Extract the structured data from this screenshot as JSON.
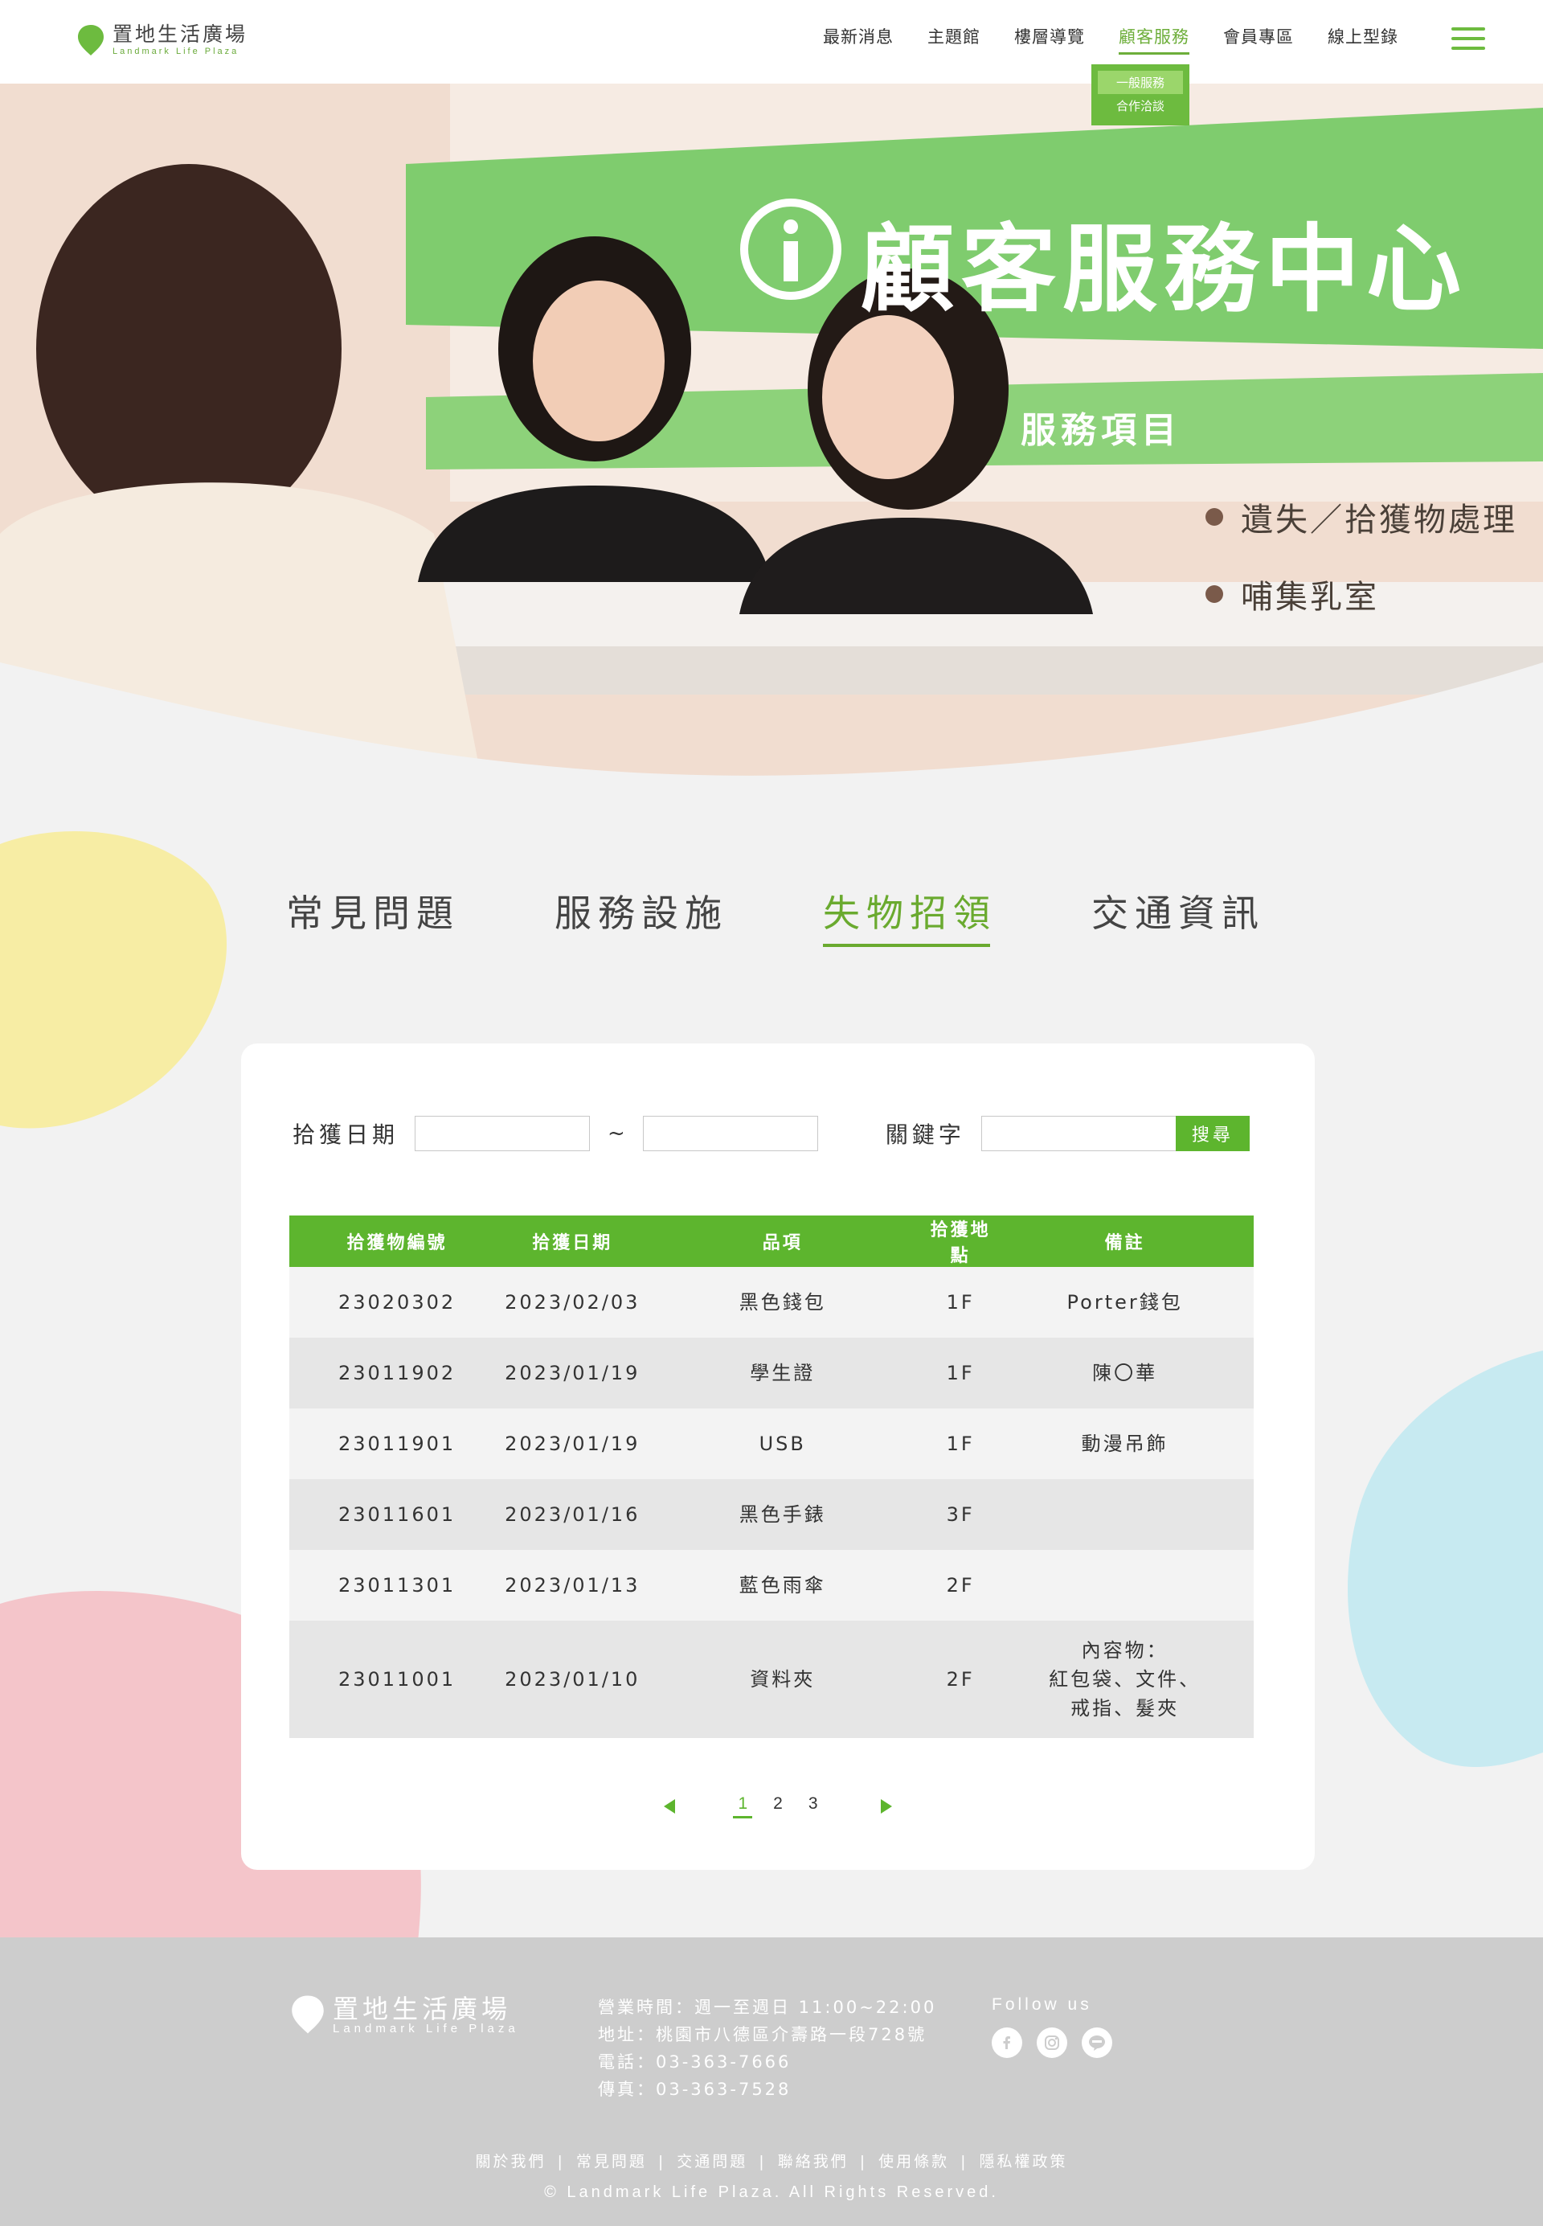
{
  "header": {
    "logo_zh": "置地生活廣場",
    "logo_en": "Landmark Life Plaza",
    "nav": [
      "最新消息",
      "主題館",
      "樓層導覽",
      "顧客服務",
      "會員專區",
      "線上型錄"
    ],
    "nav_active_index": 3,
    "dropdown": [
      "一般服務",
      "合作洽談"
    ],
    "dropdown_selected_index": 0
  },
  "hero": {
    "sign_title": "顧客服務中心",
    "sign_subtitle": "服務項目",
    "services": [
      "遺失／拾獲物處理",
      "哺集乳室"
    ]
  },
  "tabs": {
    "items": [
      "常見問題",
      "服務設施",
      "失物招領",
      "交通資訊"
    ],
    "active_index": 2
  },
  "search": {
    "date_label": "拾獲日期",
    "date_from": "",
    "separator": "~",
    "date_to": "",
    "keyword_label": "關鍵字",
    "keyword": "",
    "button_label": "搜尋"
  },
  "table": {
    "headers": [
      "拾獲物編號",
      "拾獲日期",
      "品項",
      "拾獲地點",
      "備註"
    ],
    "rows": [
      {
        "id": "23020302",
        "date": "2023/02/03",
        "item": "黑色錢包",
        "location": "1F",
        "note": "Porter錢包"
      },
      {
        "id": "23011902",
        "date": "2023/01/19",
        "item": "學生證",
        "location": "1F",
        "note": "陳〇華"
      },
      {
        "id": "23011901",
        "date": "2023/01/19",
        "item": "USB",
        "location": "1F",
        "note": "動漫吊飾"
      },
      {
        "id": "23011601",
        "date": "2023/01/16",
        "item": "黑色手錶",
        "location": "3F",
        "note": ""
      },
      {
        "id": "23011301",
        "date": "2023/01/13",
        "item": "藍色雨傘",
        "location": "2F",
        "note": ""
      },
      {
        "id": "23011001",
        "date": "2023/01/10",
        "item": "資料夾",
        "location": "2F",
        "note_lines": [
          "內容物：",
          "紅包袋、文件、",
          "戒指、髮夾"
        ]
      }
    ]
  },
  "pagination": {
    "pages": [
      "1",
      "2",
      "3"
    ],
    "current": "1"
  },
  "footer": {
    "logo_zh": "置地生活廣場",
    "logo_en": "Landmark Life Plaza",
    "hours": "營業時間：週一至週日 11:00~22:00",
    "address": "地址：桃園市八德區介壽路一段728號",
    "phone": "電話：03-363-7666",
    "fax": "傳真：03-363-7528",
    "follow_title": "Follow us",
    "social": [
      "facebook-icon",
      "instagram-icon",
      "line-icon"
    ],
    "links": [
      "關於我們",
      "常見問題",
      "交通問題",
      "聯絡我們",
      "使用條款",
      "隱私權政策"
    ],
    "copyright": "© Landmark Life Plaza. All Rights Reserved."
  },
  "colors": {
    "brand_green": "#5db52e",
    "accent_green": "#6aaa2f",
    "blob_yellow": "#f7eda4",
    "blob_blue": "#c7eaf1",
    "blob_pink": "#f4c5ca",
    "footer_gray": "#cdcdcd"
  }
}
